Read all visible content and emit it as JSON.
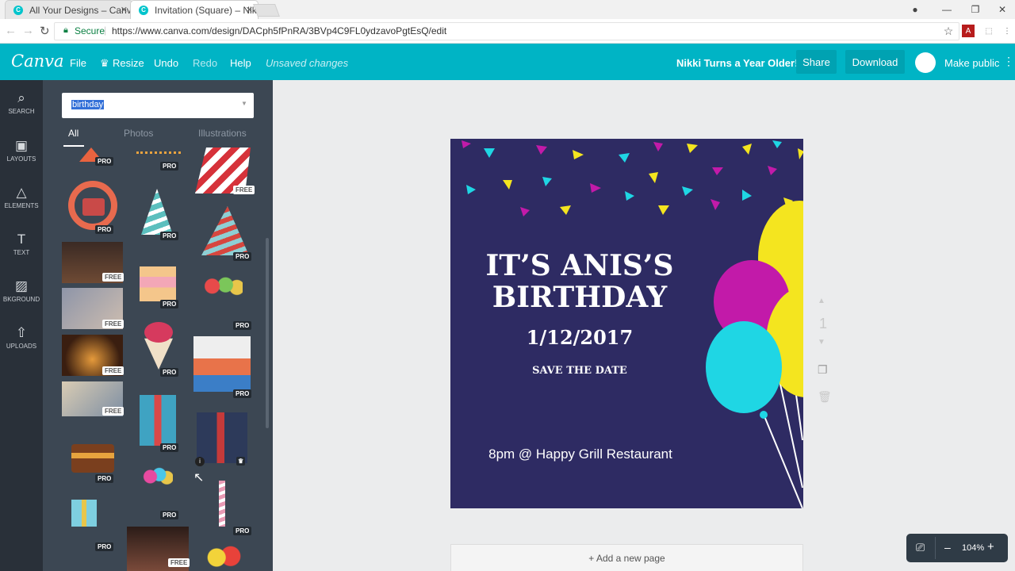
{
  "browser": {
    "tabs": [
      {
        "title": "All Your Designs – Canva"
      },
      {
        "title": "Invitation (Square) – Nikki"
      }
    ],
    "secure_label": "Secure",
    "url": "https://www.canva.com/design/DACph5fPnRA/3BVp4C9FL0ydzavoPgtEsQ/edit"
  },
  "toolbar": {
    "logo": "Canva",
    "file": "File",
    "resize": "Resize",
    "undo": "Undo",
    "redo": "Redo",
    "help": "Help",
    "status": "Unsaved changes",
    "design_title": "Nikki Turns a Year Older!",
    "share": "Share",
    "download": "Download",
    "make_public": "Make public"
  },
  "sidenav": [
    {
      "label": "SEARCH",
      "icon": "search-icon"
    },
    {
      "label": "LAYOUTS",
      "icon": "layouts-icon"
    },
    {
      "label": "ELEMENTS",
      "icon": "elements-icon"
    },
    {
      "label": "TEXT",
      "icon": "text-icon"
    },
    {
      "label": "BKGROUND",
      "icon": "background-icon"
    },
    {
      "label": "UPLOADS",
      "icon": "uploads-icon"
    }
  ],
  "panel": {
    "search_value": "birthday",
    "tabs": [
      "All",
      "Photos",
      "Illustrations"
    ],
    "badge_pro": "PRO",
    "badge_free": "FREE"
  },
  "design": {
    "title_line1": "IT’S ANIS’S",
    "title_line2": "BIRTHDAY",
    "date": "1/12/2017",
    "save_the_date": "SAVE THE DATE",
    "venue": "8pm @ Happy Grill Restaurant",
    "page_number": "1",
    "colors": {
      "background": "#2e2b63",
      "magenta": "#c21aa9",
      "cyan": "#1fd6e4",
      "yellow": "#f4e51f"
    }
  },
  "workspace": {
    "add_page": "+ Add a new page",
    "zoom": "104%",
    "zoom_minus": "–",
    "zoom_plus": "+"
  }
}
